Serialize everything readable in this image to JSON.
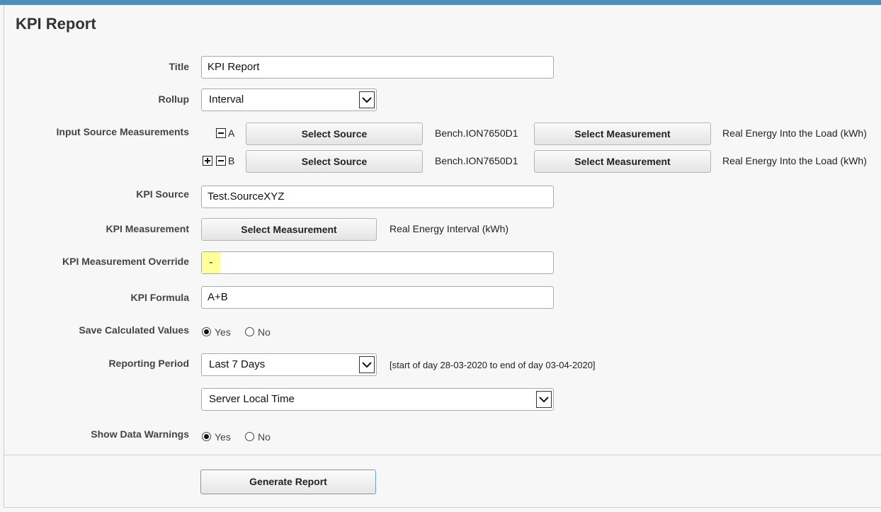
{
  "page": {
    "title": "KPI Report"
  },
  "labels": {
    "title": "Title",
    "rollup": "Rollup",
    "input_sources": "Input Source Measurements",
    "kpi_source": "KPI Source",
    "kpi_measurement": "KPI Measurement",
    "kpi_override": "KPI Measurement Override",
    "kpi_formula": "KPI Formula",
    "save_calculated": "Save Calculated Values",
    "reporting_period": "Reporting Period",
    "show_warnings": "Show Data Warnings"
  },
  "fields": {
    "title_value": "KPI Report",
    "rollup_value": "Interval",
    "kpi_source_value": "Test.SourceXYZ",
    "kpi_override_value": "-",
    "kpi_formula_value": "A+B",
    "reporting_period_value": "Last 7 Days",
    "reporting_period_range": "[start of day 28-03-2020 to end of day 03-04-2020]",
    "timezone_value": "Server Local Time"
  },
  "inputs": [
    {
      "letter": "A",
      "source_button": "Select Source",
      "source": "Bench.ION7650D1",
      "measurement_button": "Select Measurement",
      "measurement": "Real Energy Into the Load (kWh)"
    },
    {
      "letter": "B",
      "source_button": "Select Source",
      "source": "Bench.ION7650D1",
      "measurement_button": "Select Measurement",
      "measurement": "Real Energy Into the Load (kWh)"
    }
  ],
  "kpi_measurement": {
    "button": "Select Measurement",
    "value": "Real Energy Interval (kWh)"
  },
  "radios": {
    "save_yes": "Yes",
    "save_no": "No",
    "save_selected": "Yes",
    "warn_yes": "Yes",
    "warn_no": "No",
    "warn_selected": "Yes"
  },
  "actions": {
    "generate": "Generate Report"
  },
  "colors": {
    "accent": "#4f8fba",
    "override_highlight": "#ffff99"
  }
}
